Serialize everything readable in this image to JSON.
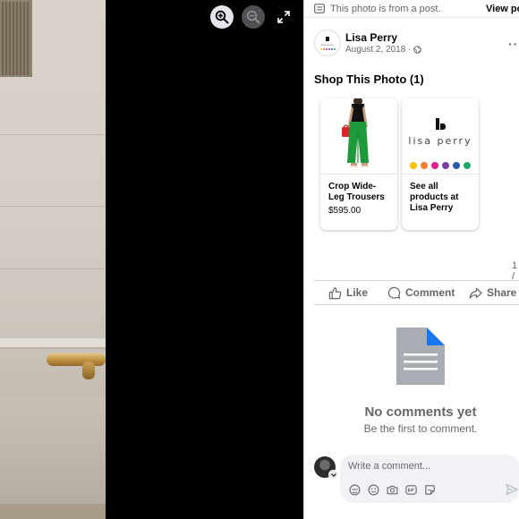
{
  "viewer": {
    "zoom_in": "zoom-in",
    "zoom_out": "zoom-out",
    "fullscreen": "fullscreen"
  },
  "notice": {
    "text": "This photo is from a post.",
    "view_post": "View po"
  },
  "post": {
    "author": "Lisa Perry",
    "date": "August 2, 2018 ·",
    "more": "···"
  },
  "shop": {
    "title": "Shop This Photo (1)",
    "products": [
      {
        "name": "Crop Wide-Leg Trousers",
        "price": "$595.00"
      },
      {
        "name": "See all products at Lisa Perry",
        "logo_text": "lisa perry"
      }
    ],
    "counter": "1 /"
  },
  "actions": {
    "like": "Like",
    "comment": "Comment",
    "share": "Share"
  },
  "comments": {
    "empty_title": "No comments yet",
    "empty_sub": "Be the first to comment."
  },
  "composer": {
    "placeholder": "Write a comment..."
  },
  "colors": {
    "brand_dots": [
      "#f5c400",
      "#ef7d32",
      "#e0218a",
      "#7b3fa0",
      "#2a5caa",
      "#1faa6b"
    ],
    "doc_blue": "#1877f2",
    "doc_gray": "#a8adb4"
  }
}
